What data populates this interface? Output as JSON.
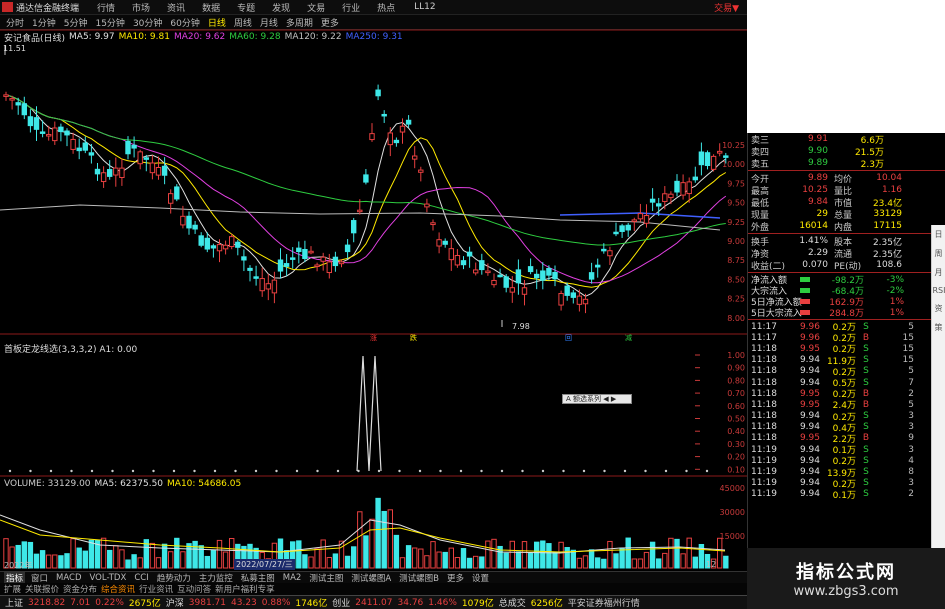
{
  "window": {
    "app_name": "通达信金融终端",
    "menus": [
      "行情",
      "市场",
      "资讯",
      "数据",
      "专题",
      "发现",
      "文易",
      "行业",
      "热点"
    ],
    "user": "LL12",
    "trade_label": "交易▼"
  },
  "periods": [
    "分时",
    "1分钟",
    "5分钟",
    "15分钟",
    "30分钟",
    "60分钟",
    "日线",
    "周线",
    "月线",
    "多周期",
    "更多"
  ],
  "active_period": "日线",
  "stock": {
    "title": "安记食品(日线)",
    "high_mark": "11.51",
    "low_mark": "7.98"
  },
  "ma_legend": [
    {
      "label": "MA5: 9.97",
      "color": "#e0e0e0"
    },
    {
      "label": "MA10: 9.81",
      "color": "#ffea00"
    },
    {
      "label": "MA20: 9.62",
      "color": "#e040e0"
    },
    {
      "label": "MA60: 9.28",
      "color": "#2ecc40"
    },
    {
      "label": "MA120: 9.22",
      "color": "#c0c0c0"
    },
    {
      "label": "MA250: 9.31",
      "color": "#4060ff"
    }
  ],
  "price_axis": [
    "10.25",
    "10.00",
    "9.75",
    "9.50",
    "9.25",
    "9.00",
    "8.75",
    "8.50",
    "8.25",
    "8.00"
  ],
  "indicator": {
    "legend": "首板定龙线选(3,3,3,2) A1: 0.00",
    "axis": [
      "1.00",
      "0.90",
      "0.80",
      "0.70",
      "0.60",
      "0.50",
      "0.40",
      "0.30",
      "0.20",
      "0.10"
    ],
    "popup": "A 额选系列 ◀ ▶"
  },
  "volume": {
    "legend": [
      {
        "label": "VOLUME: 33129.00",
        "color": "#ccc"
      },
      {
        "label": "MA5: 62375.50",
        "color": "#e0e0e0"
      },
      {
        "label": "MA10: 54686.05",
        "color": "#ffea00"
      }
    ],
    "axis": [
      "45000",
      "30000",
      "15000"
    ],
    "date_start": "2022年",
    "date_mid": "2022/07/27/三",
    "date_end": "12"
  },
  "markers": [
    {
      "text": "涨",
      "color": "#e33"
    },
    {
      "text": "跌",
      "color": "#ffea00"
    },
    {
      "text": "回",
      "color": "#3080ff"
    },
    {
      "text": "减",
      "color": "#2ecc40"
    }
  ],
  "quote": {
    "order_book": [
      {
        "l": "卖三",
        "v": "9.91",
        "n": "6.6万",
        "c": "r"
      },
      {
        "l": "卖四",
        "v": "9.90",
        "n": "21.5万",
        "c": "g"
      },
      {
        "l": "卖五",
        "v": "9.89",
        "n": "2.3万",
        "c": "g"
      }
    ],
    "stats": [
      {
        "l": "今开",
        "v": "9.89",
        "l2": "均价",
        "v2": "10.04"
      },
      {
        "l": "最高",
        "v": "10.25",
        "l2": "量比",
        "v2": "1.16"
      },
      {
        "l": "最低",
        "v": "9.84",
        "l2": "市值",
        "v2": "23.4亿"
      },
      {
        "l": "现量",
        "v": "29",
        "l2": "总量",
        "v2": "33129"
      },
      {
        "l": "外盘",
        "v": "16014",
        "l2": "内盘",
        "v2": "17115"
      }
    ],
    "stats2": [
      {
        "l": "换手",
        "v": "1.41%",
        "l2": "股本",
        "v2": "2.35亿"
      },
      {
        "l": "净资",
        "v": "2.29",
        "l2": "流通",
        "v2": "2.35亿"
      },
      {
        "l": "收益(二)",
        "v": "0.070",
        "l2": "PE(动)",
        "v2": "108.6"
      }
    ],
    "flows": [
      {
        "l": "净流入额",
        "v": "-98.2万",
        "p": "-3%",
        "c": "g"
      },
      {
        "l": "大宗流入",
        "v": "-68.4万",
        "p": "-2%",
        "c": "g"
      },
      {
        "l": "5日净流入额",
        "v": "162.9万",
        "p": "1%",
        "c": "r"
      },
      {
        "l": "5日大宗流入",
        "v": "284.8万",
        "p": "1%",
        "c": "r"
      }
    ],
    "ticks": [
      {
        "t": "11:17",
        "p": "9.96",
        "v": "0.2万",
        "b": "S",
        "n": "5"
      },
      {
        "t": "11:17",
        "p": "9.96",
        "v": "0.2万",
        "b": "B",
        "n": "15"
      },
      {
        "t": "11:18",
        "p": "9.95",
        "v": "0.2万",
        "b": "S",
        "n": "15"
      },
      {
        "t": "11:18",
        "p": "9.94",
        "v": "11.9万",
        "b": "S",
        "n": "15"
      },
      {
        "t": "11:18",
        "p": "9.94",
        "v": "0.2万",
        "b": "S",
        "n": "5"
      },
      {
        "t": "11:18",
        "p": "9.94",
        "v": "0.5万",
        "b": "S",
        "n": "7"
      },
      {
        "t": "11:18",
        "p": "9.95",
        "v": "0.2万",
        "b": "B",
        "n": "2"
      },
      {
        "t": "11:18",
        "p": "9.95",
        "v": "2.4万",
        "b": "B",
        "n": "5"
      },
      {
        "t": "11:18",
        "p": "9.94",
        "v": "0.2万",
        "b": "S",
        "n": "3"
      },
      {
        "t": "11:18",
        "p": "9.94",
        "v": "0.4万",
        "b": "S",
        "n": "3"
      },
      {
        "t": "11:18",
        "p": "9.95",
        "v": "2.2万",
        "b": "B",
        "n": "9"
      },
      {
        "t": "11:19",
        "p": "9.94",
        "v": "0.1万",
        "b": "S",
        "n": "3"
      },
      {
        "t": "11:19",
        "p": "9.94",
        "v": "0.2万",
        "b": "S",
        "n": "4"
      },
      {
        "t": "11:19",
        "p": "9.94",
        "v": "13.9万",
        "b": "S",
        "n": "8"
      },
      {
        "t": "11:19",
        "p": "9.94",
        "v": "0.2万",
        "b": "S",
        "n": "3"
      },
      {
        "t": "11:19",
        "p": "9.94",
        "v": "0.1万",
        "b": "S",
        "n": "2"
      }
    ]
  },
  "tabs": [
    "指标",
    "窗口",
    "MACD",
    "VOL-TDX",
    "CCI",
    "趋势动力",
    "主力监控",
    "私募主图",
    "MA2",
    "测试主图",
    "测试螺图A",
    "测试螺图B",
    "更多",
    "设置"
  ],
  "active_tab": "指标",
  "tabs2": [
    "扩展",
    "关联报价",
    "资金分布",
    "综合资讯",
    "行业资讯",
    "互动问答",
    "新用户福利专享"
  ],
  "status": [
    {
      "name": "上证",
      "val": "3218.82",
      "chg": "7.01",
      "pct": "0.22%",
      "amt": "2675亿"
    },
    {
      "name": "沪深",
      "val": "3981.71",
      "chg": "43.23",
      "pct": "0.88%",
      "amt": "1746亿"
    },
    {
      "name": "创业",
      "val": "2411.07",
      "chg": "34.76",
      "pct": "1.46%",
      "amt": "1079亿"
    }
  ],
  "status_extra": {
    "label": "总成交",
    "amt": "6256亿",
    "broker": "平安证券福州行情"
  },
  "watermark": {
    "line1": "指标公式网",
    "line2": "www.zbgs3.com"
  },
  "side_strip": [
    "日",
    "周",
    "月",
    "RSI",
    "资",
    "策"
  ],
  "colors": {
    "up": "#e84040",
    "down": "#3ee8e8",
    "bg": "#000000",
    "grid": "#8b1a1a"
  }
}
